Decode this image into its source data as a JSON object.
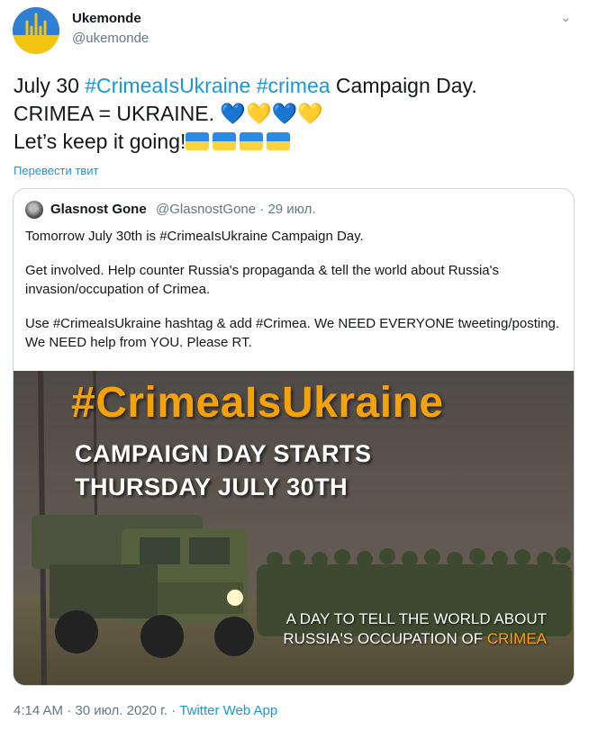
{
  "author": {
    "name": "Ukemonde",
    "handle": "@ukemonde"
  },
  "tweet": {
    "line1_pre": "July 30 ",
    "tag1": "#CrimeaIsUkraine",
    "tag2": "#crimea",
    "line1_post": " Campaign Day.",
    "line2": "CRIMEA = UKRAINE. ",
    "hearts": "💙💛💙💛",
    "line3": "Let’s keep it going!",
    "translate": "Перевести твит"
  },
  "quote": {
    "name": "Glasnost Gone",
    "meta": "@GlasnostGone · 29 июл.",
    "p1": "Tomorrow July 30th is #CrimeaIsUkraine Campaign Day.",
    "p2": "Get involved. Help counter Russia's propaganda & tell the world about Russia's invasion/occupation of Crimea.",
    "p3": "Use #CrimeaIsUkraine hashtag & add #Crimea. We NEED EVERYONE tweeting/posting. We NEED help from YOU. Please RT.",
    "image": {
      "hashtag": "#CrimeaIsUkraine",
      "line1": "CAMPAIGN DAY STARTS",
      "line2": "THURSDAY JULY 30TH",
      "foot1": "A DAY TO TELL THE WORLD ABOUT",
      "foot2_pre": "RUSSIA'S OCCUPATION OF ",
      "foot2_hl": "CRIMEA"
    }
  },
  "footer": {
    "time": "4:14 AM · 30 июл. 2020 г. · ",
    "app": "Twitter Web App"
  },
  "colors": {
    "link": "#1b95e0",
    "muted": "#657786",
    "accent": "#f5a20a"
  },
  "icons": [
    "trident-icon",
    "chevron-down-icon",
    "ukraine-flag-icon"
  ]
}
